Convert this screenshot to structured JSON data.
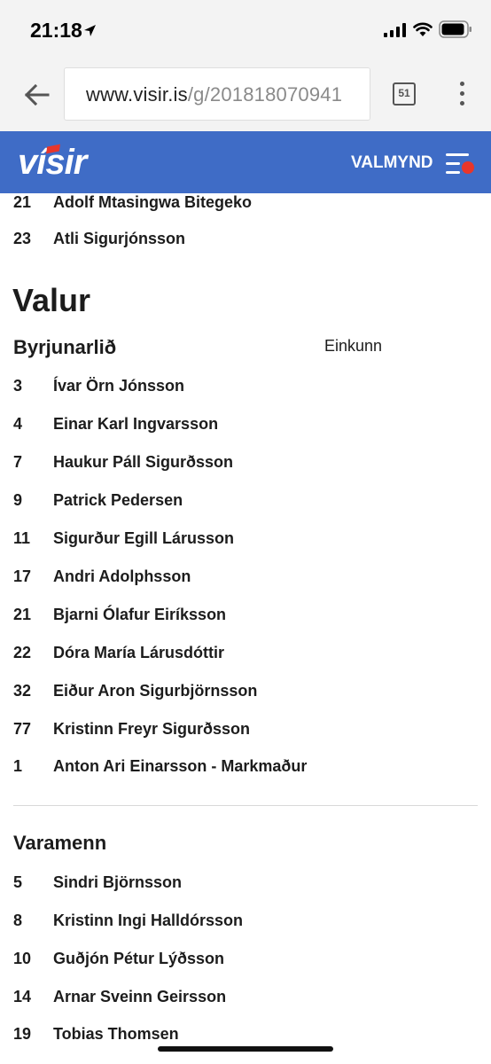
{
  "status_bar": {
    "time": "21:18"
  },
  "browser": {
    "url_host": "www.visir.is",
    "url_path": "/g/201818070941",
    "tab_count": "51"
  },
  "site": {
    "logo": "vísir",
    "menu_label": "VALMYND"
  },
  "previous_team_rows": [
    {
      "number": "21",
      "name": "Adolf Mtasingwa Bitegeko"
    },
    {
      "number": "23",
      "name": "Atli Sigurjónsson"
    }
  ],
  "team": {
    "name": "Valur",
    "starting_title": "Byrjunarlið",
    "rating_label": "Einkunn",
    "starters": [
      {
        "number": "3",
        "name": "Ívar Örn Jónsson"
      },
      {
        "number": "4",
        "name": "Einar Karl Ingvarsson"
      },
      {
        "number": "7",
        "name": "Haukur Páll Sigurðsson"
      },
      {
        "number": "9",
        "name": "Patrick Pedersen"
      },
      {
        "number": "11",
        "name": "Sigurður Egill Lárusson"
      },
      {
        "number": "17",
        "name": "Andri Adolphsson"
      },
      {
        "number": "21",
        "name": "Bjarni Ólafur Eiríksson"
      },
      {
        "number": "22",
        "name": "Dóra María Lárusdóttir"
      },
      {
        "number": "32",
        "name": "Eiður Aron Sigurbjörnsson"
      },
      {
        "number": "77",
        "name": "Kristinn Freyr Sigurðsson"
      },
      {
        "number": "1",
        "name": "Anton Ari Einarsson - Markmaður"
      }
    ],
    "subs_title": "Varamenn",
    "subs": [
      {
        "number": "5",
        "name": "Sindri Björnsson"
      },
      {
        "number": "8",
        "name": "Kristinn Ingi Halldórsson"
      },
      {
        "number": "10",
        "name": "Guðjón Pétur Lýðsson"
      },
      {
        "number": "14",
        "name": "Arnar Sveinn Geirsson"
      },
      {
        "number": "19",
        "name": "Tobias Thomsen"
      }
    ]
  }
}
